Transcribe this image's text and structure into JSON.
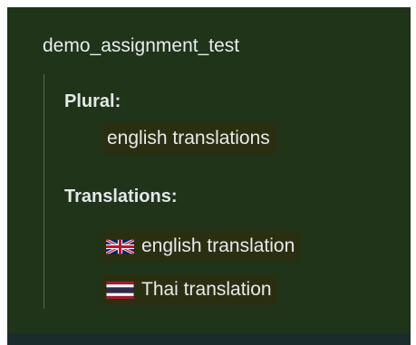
{
  "title": "demo_assignment_test",
  "plural": {
    "label": "Plural:",
    "value": "english translations"
  },
  "translations": {
    "label": "Translations:",
    "items": [
      {
        "flag": "uk-flag-icon",
        "text": "english translation"
      },
      {
        "flag": "thailand-flag-icon",
        "text": "Thai translation"
      }
    ]
  },
  "colors": {
    "panel_background": "#1f3419",
    "chip_background": "#2b2f11",
    "text": "#e9ecee",
    "bottom_bar": "#1b2c2d"
  }
}
